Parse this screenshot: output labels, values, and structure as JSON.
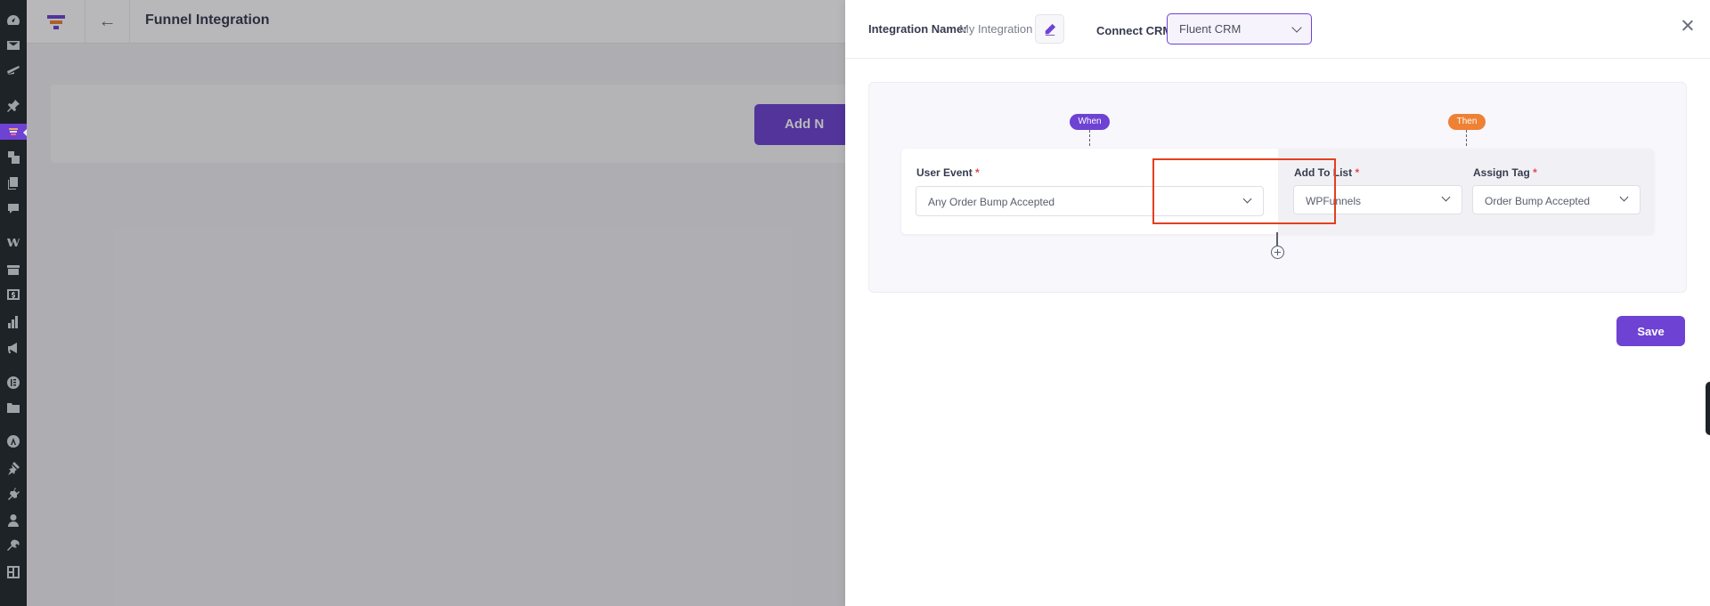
{
  "background_app": {
    "page_title": "Funnel Integration",
    "add_button_label": "Add N"
  },
  "drawer": {
    "integration_name_label": "Integration Name:",
    "integration_name_value": "My Integration",
    "connect_crm_label": "Connect CRM",
    "connect_crm_value": "Fluent CRM",
    "when_label": "When",
    "then_label": "Then",
    "user_event": {
      "label": "User Event",
      "required_mark": "*",
      "value": "Any Order Bump Accepted"
    },
    "add_to_list": {
      "label": "Add To List",
      "required_mark": "*",
      "value": "WPFunnels"
    },
    "assign_tag": {
      "label": "Assign Tag",
      "required_mark": "*",
      "value": "Order Bump Accepted"
    },
    "save_label": "Save"
  },
  "colors": {
    "accent": "#6e42d3",
    "then_pill": "#ee8134",
    "highlight": "#e3401e",
    "wp_sidebar": "#1d2327"
  },
  "icons": [
    "dashboard-icon",
    "mail-icon",
    "brush-icon",
    "pin-icon",
    "funnel-icon",
    "media-icon",
    "pages-icon",
    "comments-icon",
    "woo-icon",
    "products-icon",
    "payments-icon",
    "analytics-icon",
    "marketing-icon",
    "elementor-icon",
    "folder-icon",
    "astra-icon",
    "appearance-icon",
    "plugins-icon",
    "users-icon",
    "tools-icon",
    "settings-icon"
  ]
}
